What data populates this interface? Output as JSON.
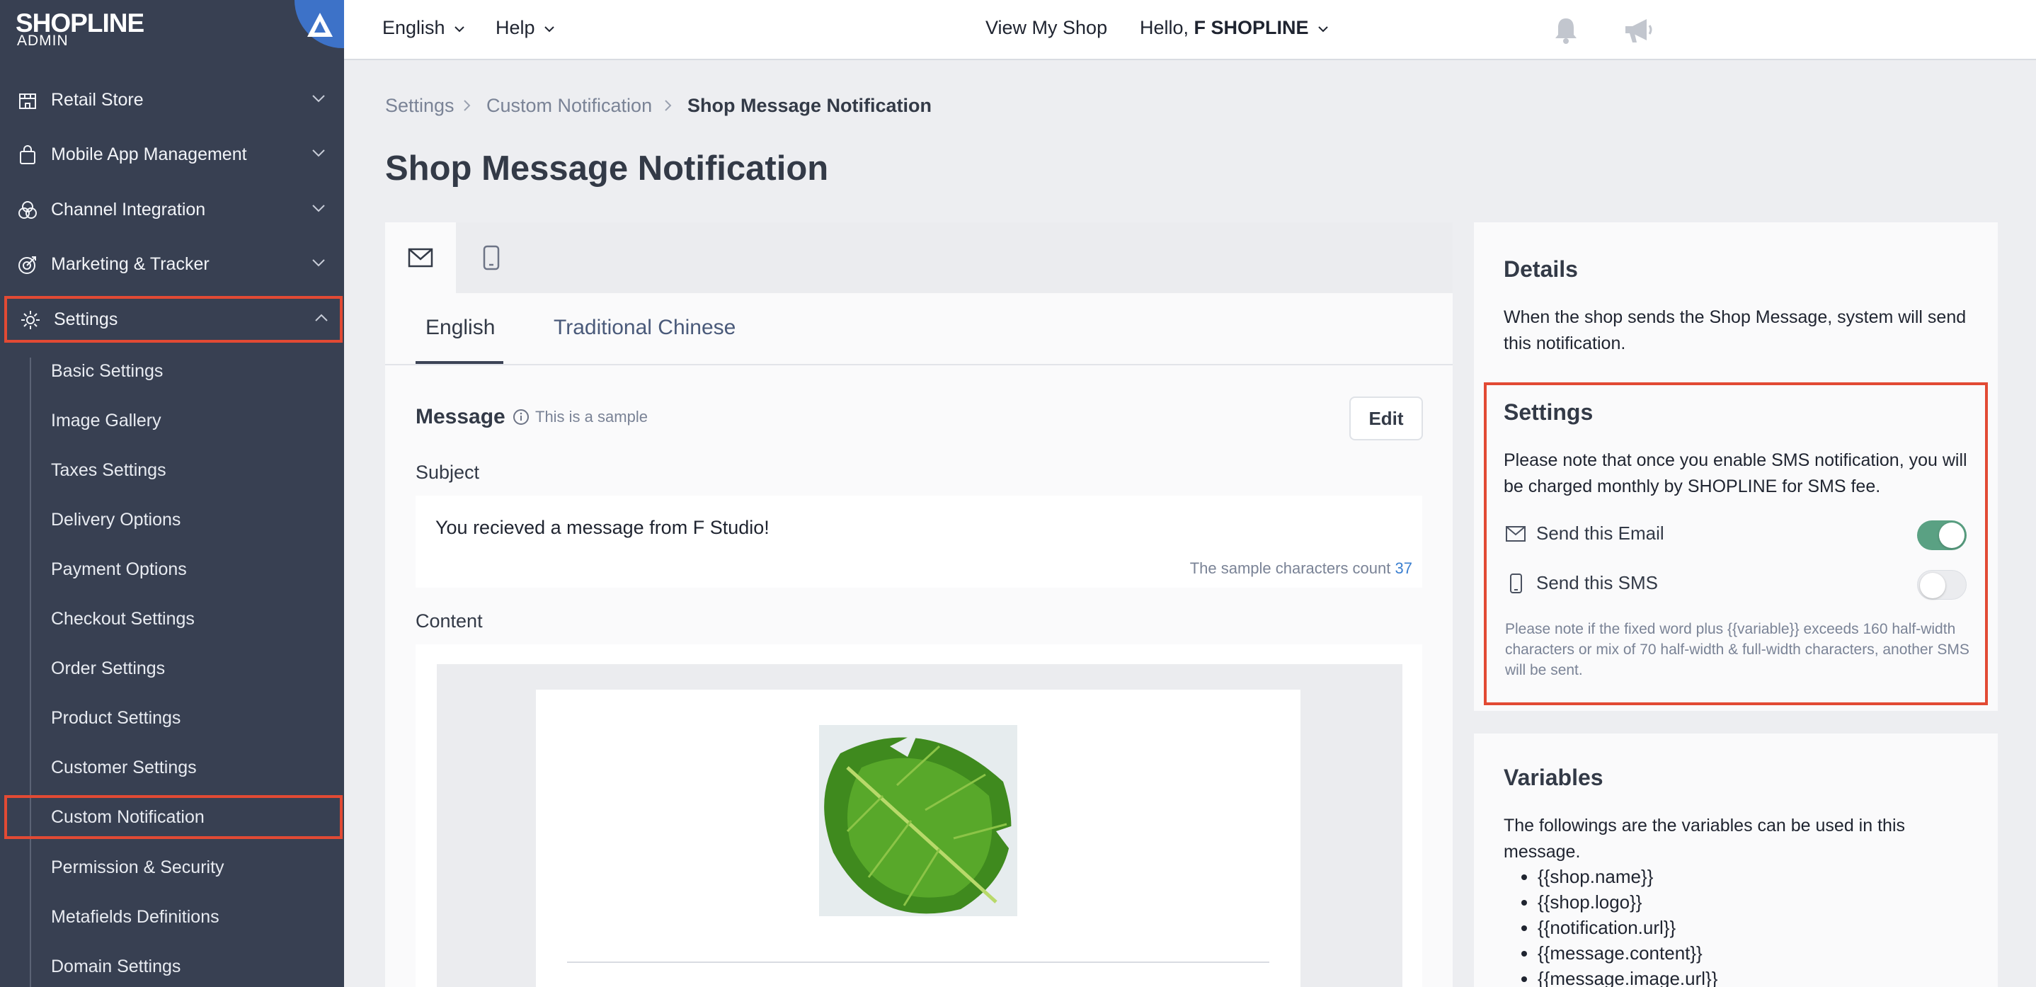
{
  "brand": {
    "name": "SHOPLINE",
    "sub": "ADMIN"
  },
  "sidebar": {
    "sections": [
      {
        "label": "Retail Store",
        "icon": "store-icon"
      },
      {
        "label": "Mobile App Management",
        "icon": "shopping-bag-icon"
      },
      {
        "label": "Channel Integration",
        "icon": "channels-icon"
      },
      {
        "label": "Marketing & Tracker",
        "icon": "target-icon"
      },
      {
        "label": "Settings",
        "icon": "gear-icon"
      }
    ],
    "sub_items": [
      "Basic Settings",
      "Image Gallery",
      "Taxes Settings",
      "Delivery Options",
      "Payment Options",
      "Checkout Settings",
      "Order Settings",
      "Product Settings",
      "Customer Settings",
      "Custom Notification",
      "Permission & Security",
      "Metafields Definitions",
      "Domain Settings"
    ]
  },
  "topbar": {
    "language": "English",
    "help": "Help",
    "view_shop": "View My Shop",
    "greeting": "Hello,",
    "user": "F SHOPLINE"
  },
  "breadcrumb": [
    "Settings",
    "Custom Notification",
    "Shop Message Notification"
  ],
  "page_title": "Shop Message Notification",
  "lang_tabs": [
    "English",
    "Traditional Chinese"
  ],
  "message": {
    "label": "Message",
    "sample_note": "This is a sample",
    "edit": "Edit",
    "subject_label": "Subject",
    "subject": "You recieved a message from F Studio!",
    "count_label": "The sample characters count",
    "count": "37",
    "content_label": "Content"
  },
  "details": {
    "title": "Details",
    "text": "When the shop sends the Shop Message, system will send this notification."
  },
  "settings_card": {
    "title": "Settings",
    "text": "Please note that once you enable SMS notification, you will be charged monthly by SHOPLINE for SMS fee.",
    "email_label": "Send this Email",
    "email_on": true,
    "sms_label": "Send this SMS",
    "sms_on": false,
    "sms_note": "Please note if the fixed word plus {{variable}} exceeds 160 half-width characters or mix of 70 half-width & full-width characters, another SMS will be sent."
  },
  "variables": {
    "title": "Variables",
    "text": "The followings are the variables can be used in this message.",
    "items": [
      "{{shop.name}}",
      "{{shop.logo}}",
      "{{notification.url}}",
      "{{message.content}}",
      "{{message.image.url}}"
    ]
  },
  "colors": {
    "sidebar": "#384052",
    "accent_red": "#e24a34",
    "toggle_on": "#5aa183",
    "link_blue": "#3b7fd0"
  }
}
